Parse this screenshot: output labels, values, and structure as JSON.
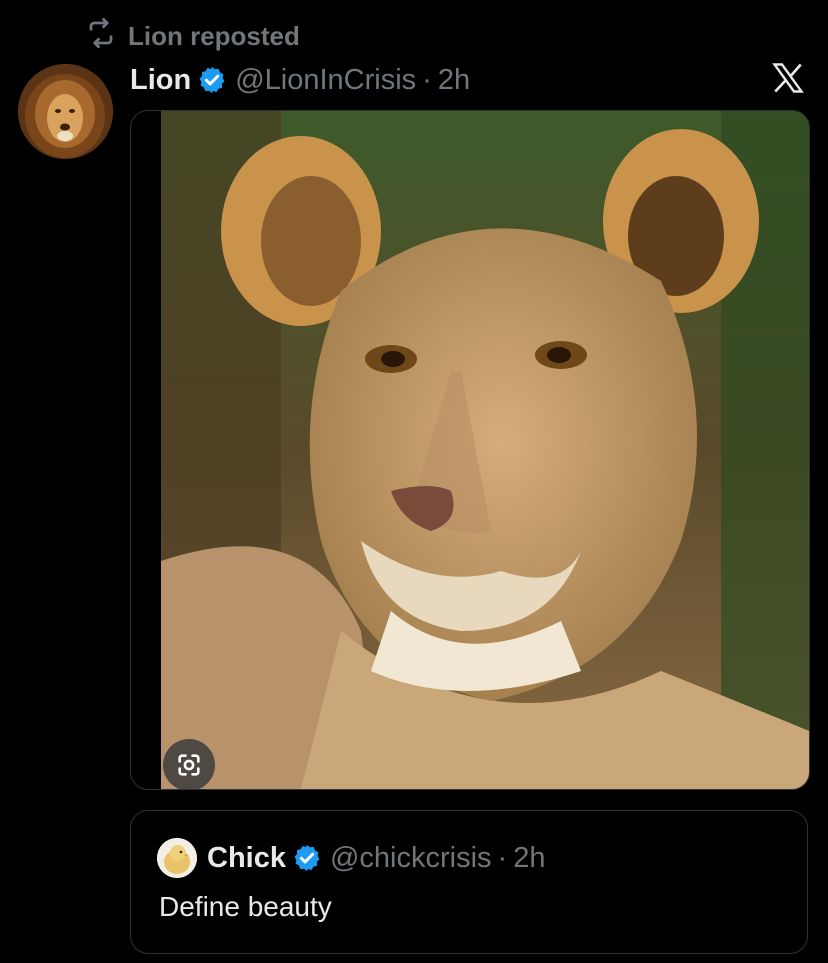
{
  "repost": {
    "icon": "repost-icon",
    "label": "Lion reposted"
  },
  "post": {
    "avatar_icon": "lion-avatar",
    "name": "Lion",
    "handle": "@LionInCrisis",
    "separator": "·",
    "time": "2h",
    "verified_icon": "verified-badge-icon",
    "platform_icon": "x-logo-icon",
    "media": {
      "subject": "lioness-photo",
      "overlay_icon": "lens-search-icon"
    }
  },
  "quote": {
    "avatar_icon": "chick-avatar",
    "name": "Chick",
    "handle": "@chickcrisis",
    "separator": "·",
    "time": "2h",
    "text": "Define beauty"
  },
  "colors": {
    "background": "#000000",
    "text": "#e7e9ea",
    "secondary": "#71767b",
    "verified": "#1d9bf0",
    "border": "#2f3336"
  }
}
